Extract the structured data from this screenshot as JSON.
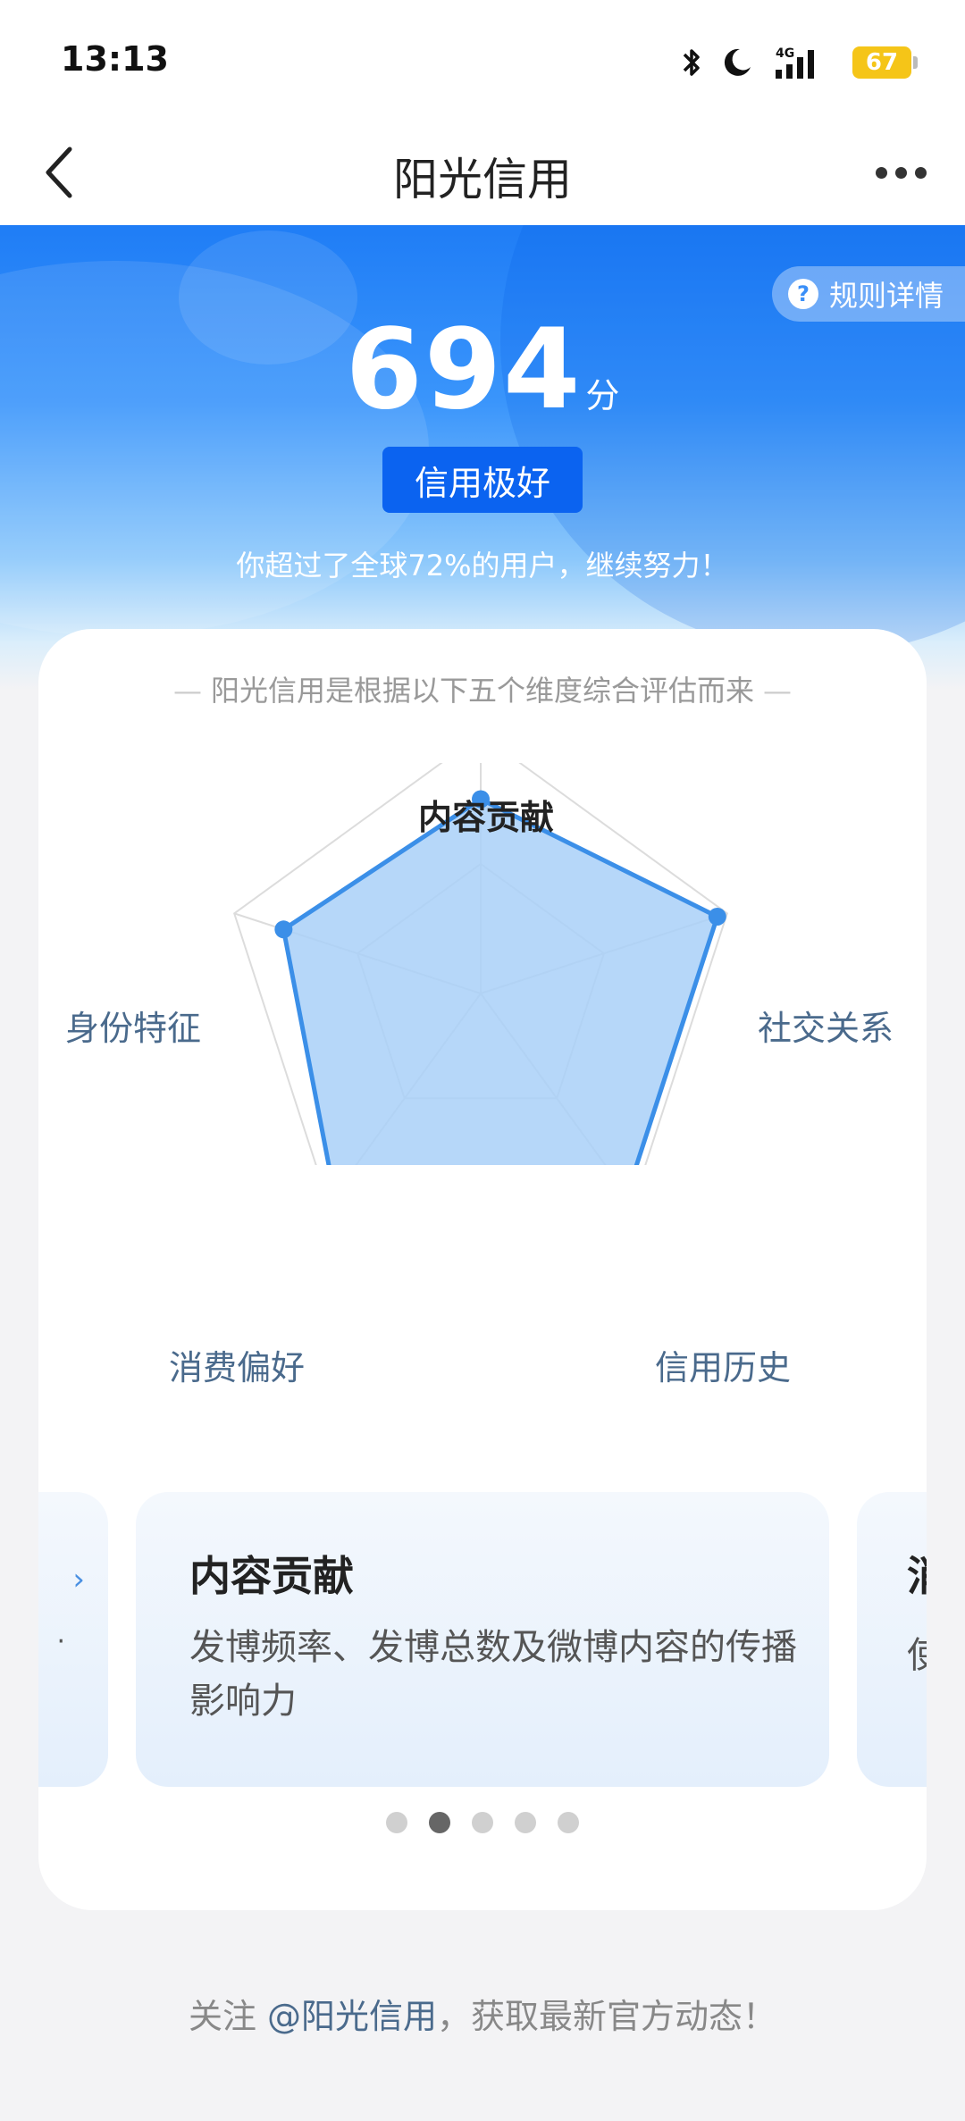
{
  "status_bar": {
    "time": "13:13",
    "network": "4G",
    "battery": "67",
    "icons": [
      "bluetooth-icon",
      "moon-icon",
      "signal-icon",
      "battery-icon"
    ]
  },
  "nav": {
    "title": "阳光信用",
    "back_icon": "chevron-left-icon",
    "more_icon": "more-dots-icon"
  },
  "hero": {
    "rules_label": "规则详情",
    "rules_icon": "?",
    "score": "694",
    "score_unit": "分",
    "level": "信用极好",
    "note": "你超过了全球72%的用户，继续努力！"
  },
  "card": {
    "subtitle": "阳光信用是根据以下五个维度综合评估而来",
    "dimensions": [
      {
        "label": "内容贡献",
        "value": 0.75,
        "active": true
      },
      {
        "label": "社交关系",
        "value": 0.96,
        "active": false
      },
      {
        "label": "信用历史",
        "value": 0.96,
        "active": false
      },
      {
        "label": "消费偏好",
        "value": 0.96,
        "active": false
      },
      {
        "label": "身份特征",
        "value": 0.8,
        "active": false
      }
    ],
    "carousel": {
      "prev_fragment": "›",
      "prev_dot": "·",
      "current_title": "内容贡献",
      "current_desc": "发博频率、发博总数及微博内容的传播影响力",
      "next_title_fragment": "消",
      "next_desc_fragment": "使",
      "page_count": 5,
      "active_page": 2
    }
  },
  "footer": {
    "prefix": "关注 ",
    "mention": "@阳光信用",
    "suffix": "，获取最新官方动态！"
  },
  "colors": {
    "brand_blue": "#1f7df6",
    "badge_blue": "#0b63f0",
    "radar_stroke": "#3b8fe8",
    "radar_fill": "#a9d0f8"
  }
}
